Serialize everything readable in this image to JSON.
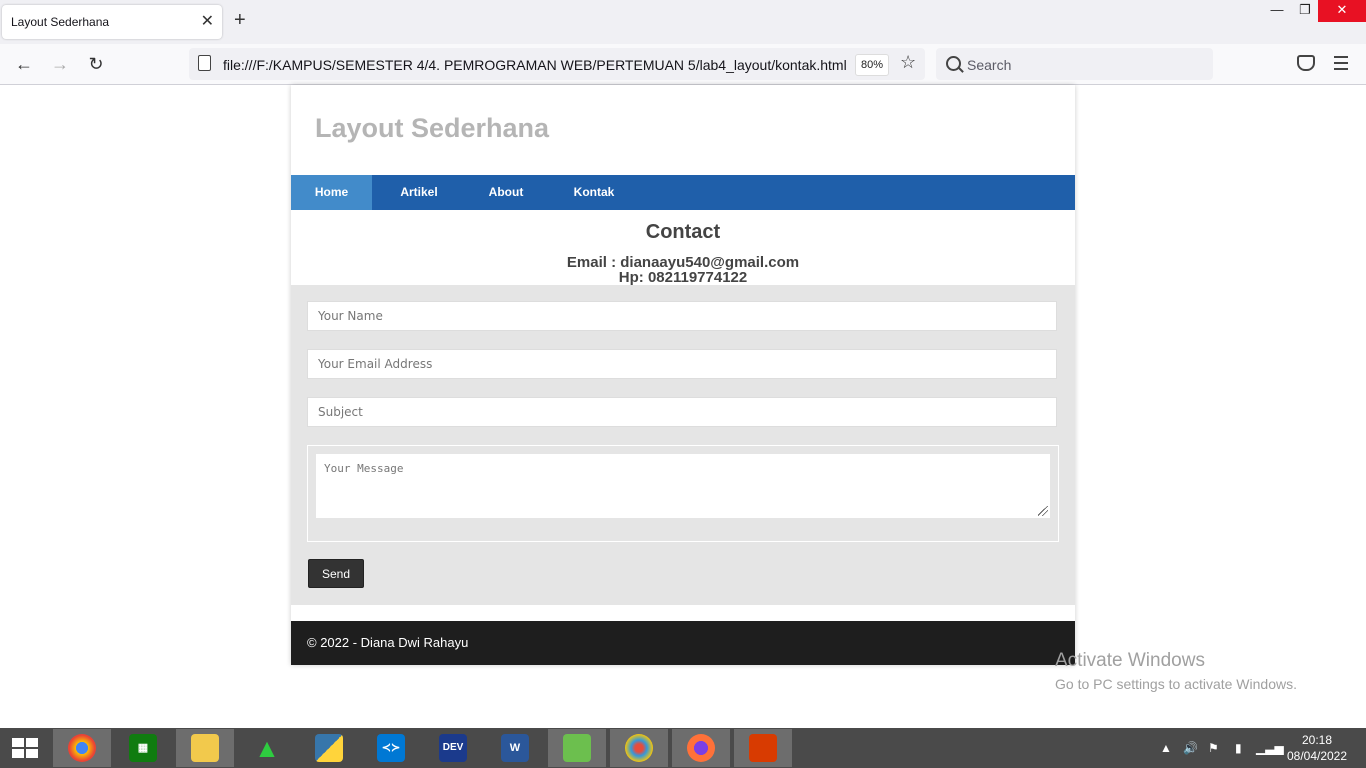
{
  "browser": {
    "tab_title": "Layout Sederhana",
    "url": "file:///F:/KAMPUS/SEMESTER 4/4. PEMROGRAMAN WEB/PERTEMUAN 5/lab4_layout/kontak.html",
    "zoom": "80%",
    "search_placeholder": "Search"
  },
  "page": {
    "site_title": "Layout Sederhana",
    "nav": [
      "Home",
      "Artikel",
      "About",
      "Kontak"
    ],
    "active_nav": "Home",
    "contact_title": "Contact",
    "email_line": "Email : dianaayu540@gmail.com",
    "hp_line": "Hp: 082119774122",
    "form": {
      "name_placeholder": "Your Name",
      "email_placeholder": "Your Email Address",
      "subject_placeholder": "Subject",
      "message_placeholder": "Your Message",
      "send_label": "Send"
    },
    "footer": "© 2022 - Diana Dwi Rahayu"
  },
  "watermark": {
    "line1": "Activate Windows",
    "line2": "Go to PC settings to activate Windows."
  },
  "taskbar": {
    "apps": [
      "chrome-icon",
      "store-icon",
      "file-explorer-icon",
      "sublime-icon",
      "python-icon",
      "vscode-icon",
      "devcpp-icon",
      "word-icon",
      "notepad-icon",
      "paint-icon",
      "firefox-icon",
      "office-icon"
    ],
    "time": "20:18",
    "date": "08/04/2022"
  },
  "colors": {
    "nav_bg": "#1f5faa",
    "nav_active": "#428bca",
    "form_bg": "#e5e5e5",
    "footer_bg": "#1e1e1e"
  }
}
